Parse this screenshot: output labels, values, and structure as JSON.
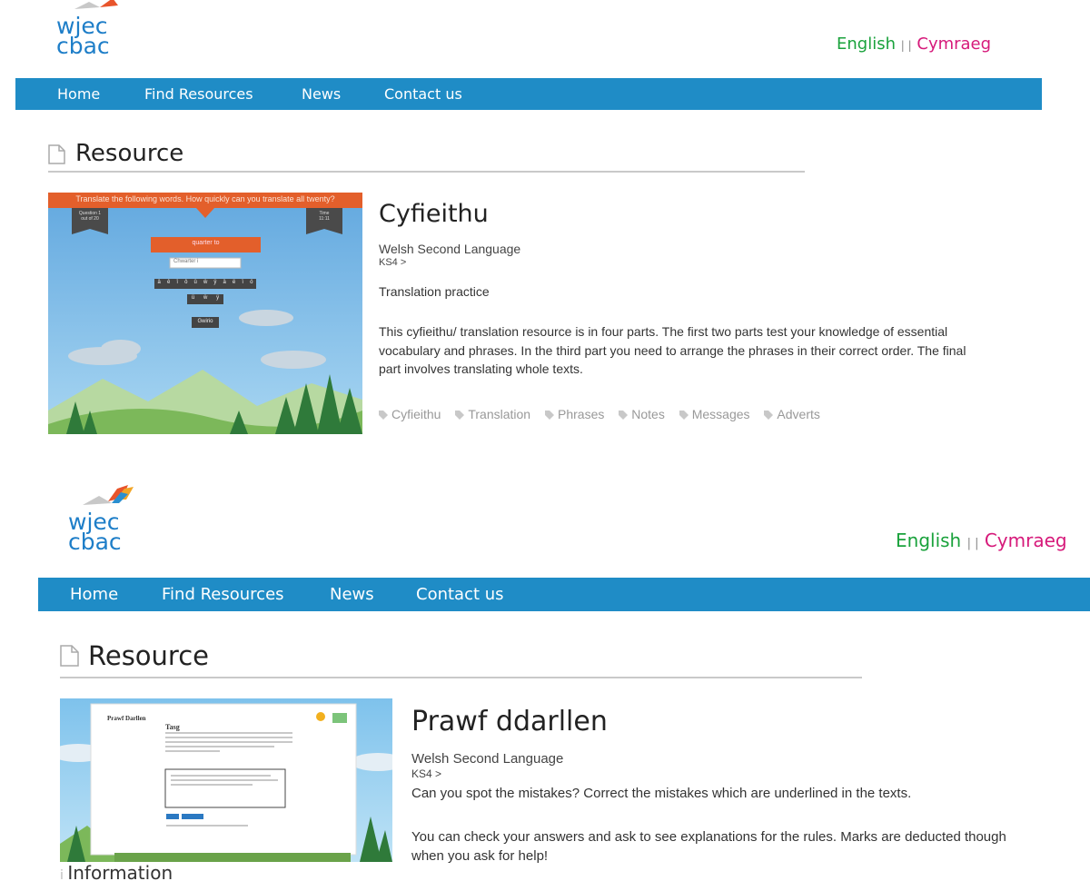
{
  "panels": [
    {
      "logo": {
        "line1": "wjec",
        "line2": "cbac"
      },
      "lang": {
        "english": "English",
        "sep": "| |",
        "cymraeg": "Cymraeg"
      },
      "nav": [
        "Home",
        "Find Resources",
        "News",
        "Contact us"
      ],
      "section_title": "Resource",
      "resource": {
        "title": "Cyfieithu",
        "subject": "Welsh Second Language",
        "stage": "KS4 >",
        "summary": "Translation practice",
        "description": "This cyfieithu/ translation resource is in four parts. The first two parts test your knowledge of essential vocabulary and phrases.  In the third part you need to arrange the phrases in their correct order.  The final part involves translating whole texts.",
        "tags": [
          "Cyfieithu",
          "Translation",
          "Phrases",
          "Notes",
          "Messages",
          "Adverts"
        ]
      },
      "thumbnail": {
        "banner": "Translate the following words. How quickly can you translate all twenty?",
        "left_box": "Question 1\nout of 20",
        "right_box": "Time\n11:11",
        "prompt": "quarter to",
        "input": "Chwarter i",
        "keys_row1": [
          "â",
          "ê",
          "î",
          "ô",
          "û",
          "ŵ",
          "ŷ",
          "ä",
          "ë",
          "ï",
          "ö"
        ],
        "keys_row2": [
          "ü",
          "ẅ",
          "ÿ"
        ],
        "button": "Gwirio"
      }
    },
    {
      "logo": {
        "line1": "wjec",
        "line2": "cbac"
      },
      "lang": {
        "english": "English",
        "sep": "| |",
        "cymraeg": "Cymraeg"
      },
      "nav": [
        "Home",
        "Find Resources",
        "News",
        "Contact us"
      ],
      "section_title": "Resource",
      "resource": {
        "title": "Prawf ddarllen",
        "subject": "Welsh Second Language",
        "stage": "KS4 >",
        "summary": "Can you spot the mistakes? Correct the mistakes which are underlined in the texts.",
        "description": "You can check your answers and ask to see explanations for the rules. Marks are deducted though when you ask for help!"
      },
      "thumbnail": {
        "heading": "Prawf Darllen",
        "subheading": "Tasg"
      },
      "info_label": "Information"
    }
  ],
  "colors": {
    "nav": "#1f8cc6",
    "english": "#1aa23c",
    "cymraeg": "#d6197a",
    "logo": "#1e7ec8",
    "orange": "#e35f2b"
  }
}
